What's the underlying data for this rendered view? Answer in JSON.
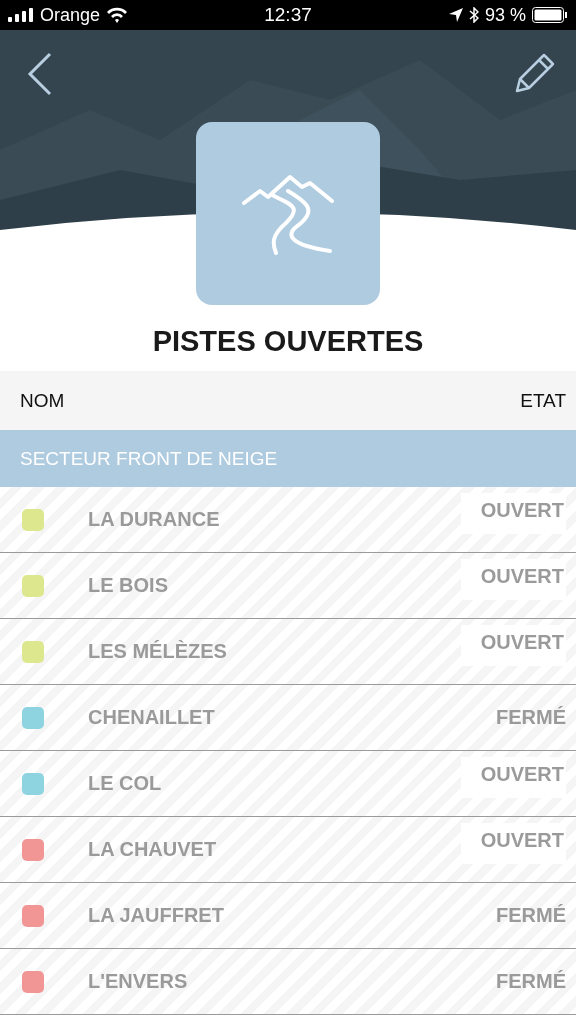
{
  "status_bar": {
    "carrier": "Orange",
    "time": "12:37",
    "battery": "93 %"
  },
  "header": {
    "title": "PISTES OUVERTES"
  },
  "table": {
    "columns": [
      "NOM",
      "ETAT"
    ],
    "section": "SECTEUR FRONT DE NEIGE",
    "rows": [
      {
        "name": "LA DURANCE",
        "state": "OUVERT",
        "open": true,
        "color": "#dde88e"
      },
      {
        "name": "LE BOIS",
        "state": "OUVERT",
        "open": true,
        "color": "#dde88e"
      },
      {
        "name": "LES MÉLÈZES",
        "state": "OUVERT",
        "open": true,
        "color": "#dde88e"
      },
      {
        "name": "CHENAILLET",
        "state": "FERMÉ",
        "open": false,
        "color": "#8ed3e0"
      },
      {
        "name": "LE COL",
        "state": "OUVERT",
        "open": true,
        "color": "#8ed3e0"
      },
      {
        "name": "LA CHAUVET",
        "state": "OUVERT",
        "open": true,
        "color": "#f29595"
      },
      {
        "name": "LA JAUFFRET",
        "state": "FERMÉ",
        "open": false,
        "color": "#f29595"
      },
      {
        "name": "L'ENVERS",
        "state": "FERMÉ",
        "open": false,
        "color": "#f29595"
      }
    ]
  }
}
